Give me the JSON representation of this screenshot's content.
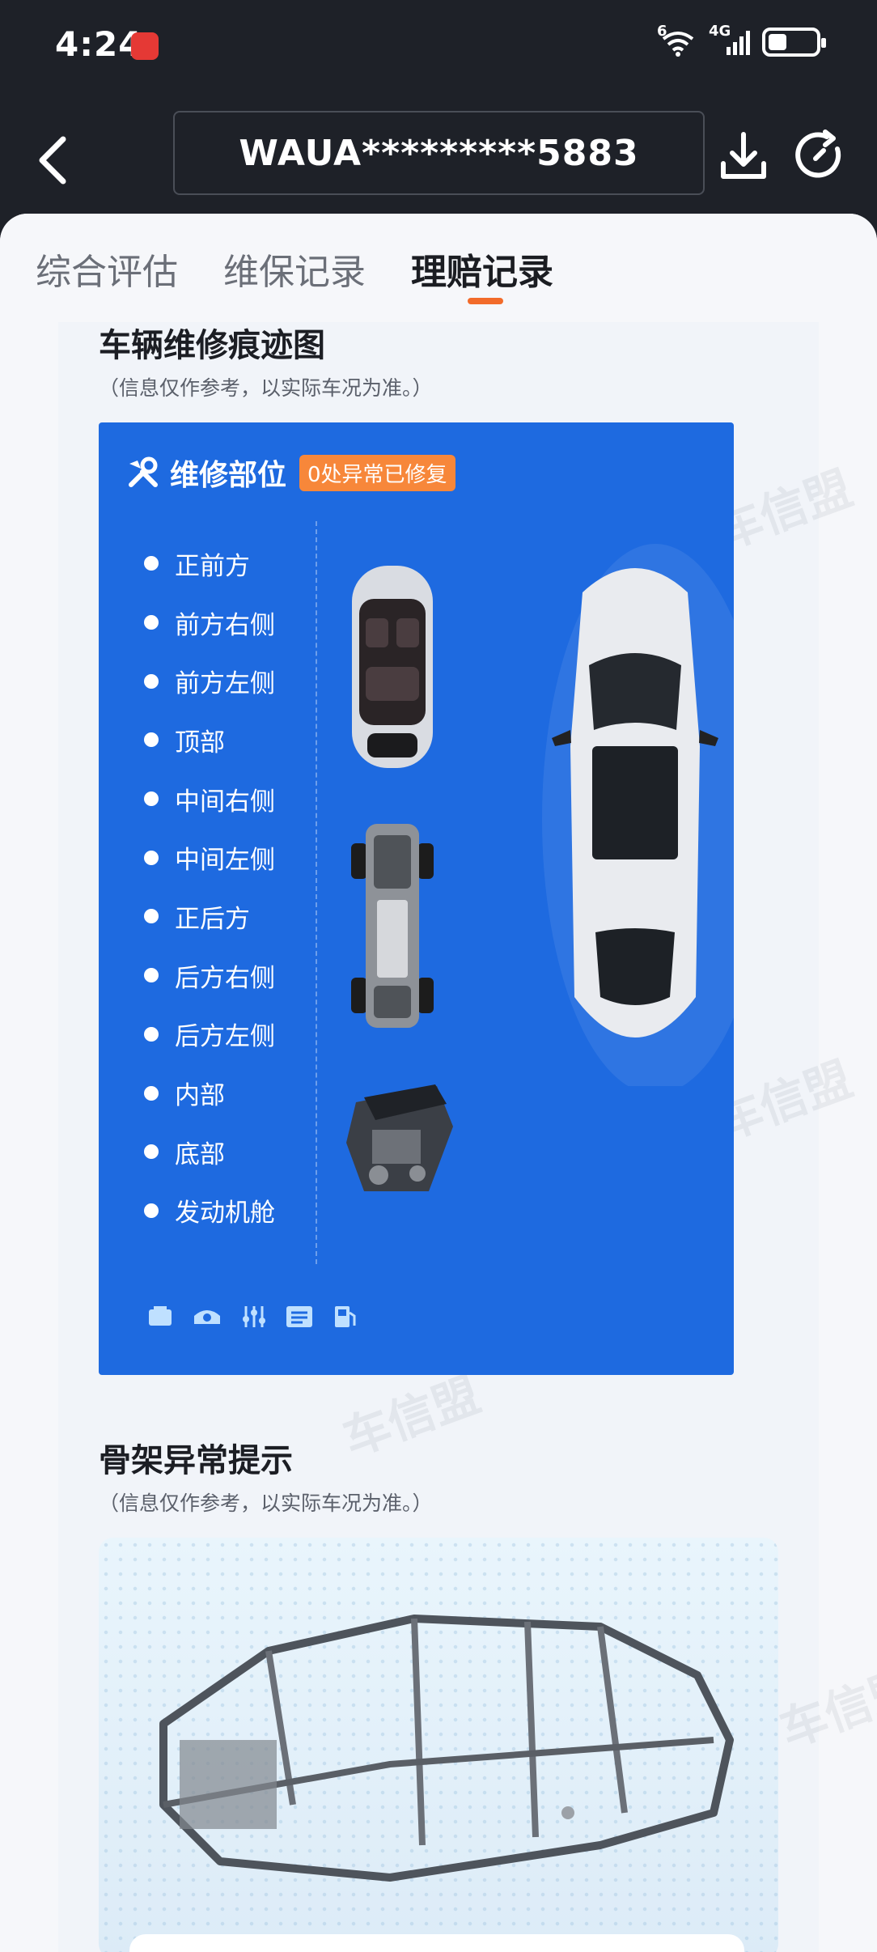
{
  "status_bar": {
    "time": "4:24",
    "wifi_label": "6",
    "network_label": "4G"
  },
  "header": {
    "vin": "WAUA*********5883"
  },
  "tabs": [
    {
      "label": "综合评估",
      "active": false
    },
    {
      "label": "维保记录",
      "active": false
    },
    {
      "label": "理赔记录",
      "active": true
    }
  ],
  "watermark": "车信盟",
  "repair_map": {
    "title": "车辆维修痕迹图",
    "note": "（信息仅作参考，以实际车况为准。）",
    "card_title": "维修部位",
    "badge": "0处异常已修复",
    "parts": [
      "正前方",
      "前方右侧",
      "前方左侧",
      "顶部",
      "中间右侧",
      "中间左侧",
      "正后方",
      "后方右侧",
      "后方左侧",
      "内部",
      "底部",
      "发动机舱"
    ]
  },
  "frame_alert": {
    "title": "骨架异常提示",
    "note": "（信息仅作参考，以实际车况为准。）"
  },
  "colors": {
    "accent": "#f26b2a",
    "card_blue": "#1e6ae0",
    "badge_orange": "#f7873a"
  }
}
